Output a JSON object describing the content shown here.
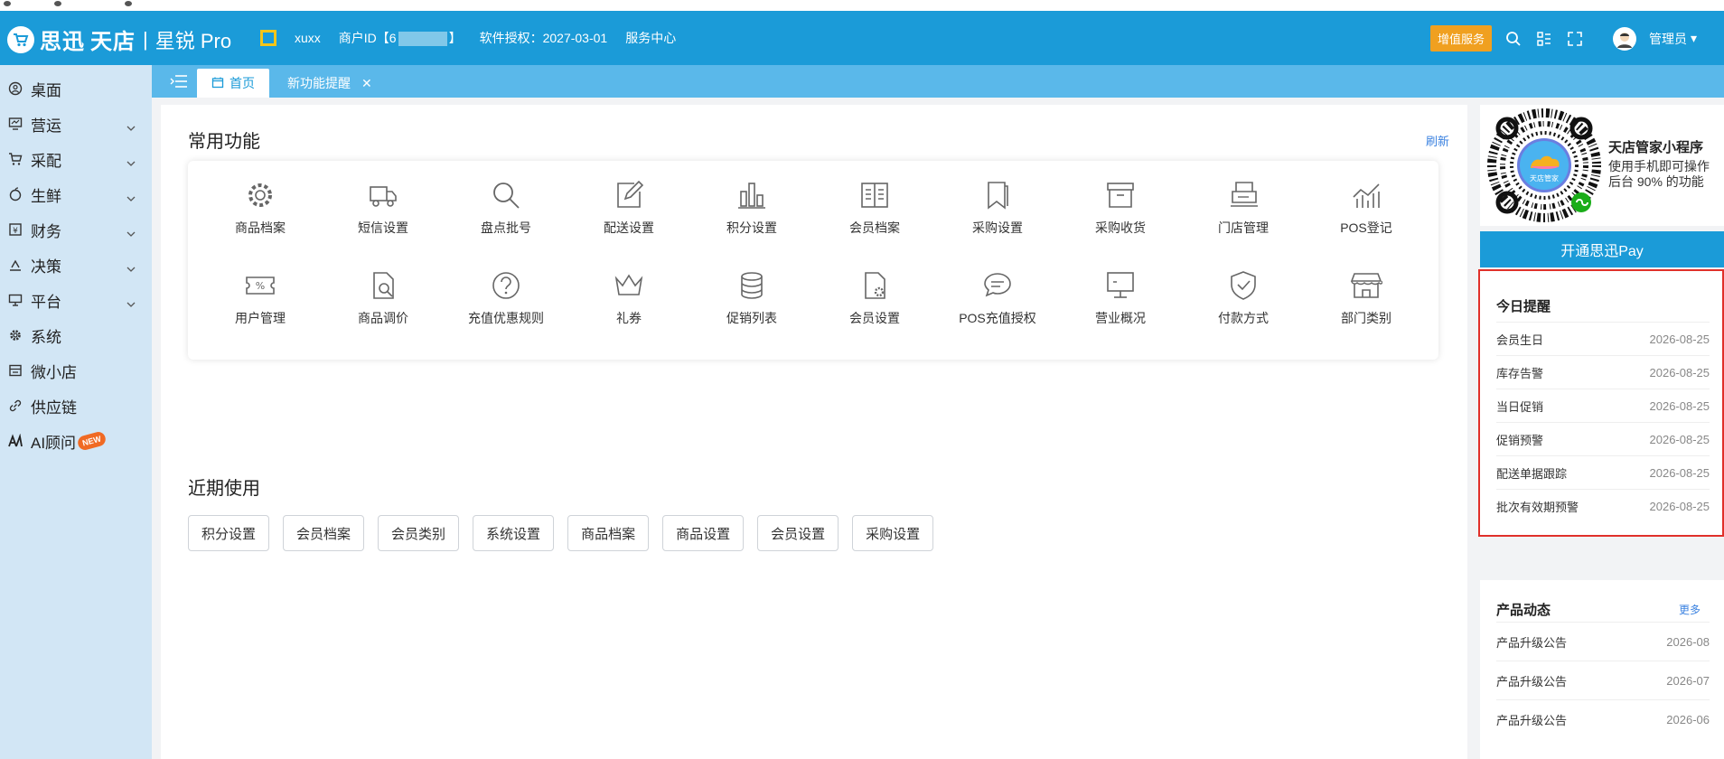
{
  "header": {
    "brand": "思迅",
    "brand2": "天店",
    "sep": "|",
    "product": "星锐 Pro",
    "username": "xuxx",
    "merchant_prefix": "商户ID【6",
    "merchant_suffix": "】",
    "license": "软件授权：2027-03-01",
    "service": "服务中心",
    "vip_label": "增值服务",
    "admin_label": "管理员"
  },
  "sidebar": {
    "items": [
      {
        "label": "桌面",
        "icon": "desktop-icon",
        "chevron": false
      },
      {
        "label": "营运",
        "icon": "operations-icon",
        "chevron": true
      },
      {
        "label": "采配",
        "icon": "cart-icon",
        "chevron": true
      },
      {
        "label": "生鲜",
        "icon": "fresh-icon",
        "chevron": true
      },
      {
        "label": "财务",
        "icon": "finance-icon",
        "chevron": true
      },
      {
        "label": "决策",
        "icon": "decision-icon",
        "chevron": true
      },
      {
        "label": "平台",
        "icon": "platform-icon",
        "chevron": true
      },
      {
        "label": "系统",
        "icon": "gear-icon",
        "chevron": false
      },
      {
        "label": "微小店",
        "icon": "shop-icon",
        "chevron": false
      },
      {
        "label": "供应链",
        "icon": "link-icon",
        "chevron": false
      },
      {
        "label": "AI顾问",
        "icon": "ai-icon",
        "chevron": false
      }
    ],
    "new_badge": "NEW"
  },
  "tabs": {
    "home": "首页",
    "notice": "新功能提醒",
    "close": "✕"
  },
  "main": {
    "common_title": "常用功能",
    "refresh": "刷新",
    "functions": [
      {
        "label": "商品档案",
        "icon": "gear-icon"
      },
      {
        "label": "短信设置",
        "icon": "truck-icon"
      },
      {
        "label": "盘点批号",
        "icon": "search-icon"
      },
      {
        "label": "配送设置",
        "icon": "edit-icon"
      },
      {
        "label": "积分设置",
        "icon": "bar-chart-icon"
      },
      {
        "label": "会员档案",
        "icon": "book-icon"
      },
      {
        "label": "采购设置",
        "icon": "bookmark-icon"
      },
      {
        "label": "采购收货",
        "icon": "archive-icon"
      },
      {
        "label": "门店管理",
        "icon": "printer-icon"
      },
      {
        "label": "POS登记",
        "icon": "trend-icon"
      },
      {
        "label": "用户管理",
        "icon": "ticket-icon"
      },
      {
        "label": "商品调价",
        "icon": "doc-search-icon"
      },
      {
        "label": "充值优惠规则",
        "icon": "question-icon"
      },
      {
        "label": "礼券",
        "icon": "crown-icon"
      },
      {
        "label": "促销列表",
        "icon": "database-icon"
      },
      {
        "label": "会员设置",
        "icon": "doc-gear-icon"
      },
      {
        "label": "POS充值授权",
        "icon": "chat-icon"
      },
      {
        "label": "营业概况",
        "icon": "monitor-icon"
      },
      {
        "label": "付款方式",
        "icon": "shield-icon"
      },
      {
        "label": "部门类别",
        "icon": "store-icon"
      }
    ],
    "recent_title": "近期使用",
    "recent": [
      "积分设置",
      "会员档案",
      "会员类别",
      "系统设置",
      "商品档案",
      "商品设置",
      "会员设置",
      "采购设置"
    ]
  },
  "right": {
    "qr_title": "天店管家小程序",
    "qr_desc": "使用手机即可操作后台 90% 的功能",
    "qr_center_label": "天店管家",
    "pay_button": "开通思迅Pay",
    "remind_title": "今日提醒",
    "reminders": [
      {
        "label": "会员生日",
        "date": "2026-08-25"
      },
      {
        "label": "库存告警",
        "date": "2026-08-25"
      },
      {
        "label": "当日促销",
        "date": "2026-08-25"
      },
      {
        "label": "促销预警",
        "date": "2026-08-25"
      },
      {
        "label": "配送单据跟踪",
        "date": "2026-08-25"
      },
      {
        "label": "批次有效期预警",
        "date": "2026-08-25"
      }
    ],
    "dynamic_title": "产品动态",
    "more": "更多",
    "dynamics": [
      {
        "label": "产品升级公告",
        "date": "2026-08"
      },
      {
        "label": "产品升级公告",
        "date": "2026-07"
      },
      {
        "label": "产品升级公告",
        "date": "2026-06"
      }
    ]
  },
  "colors": {
    "header": "#1b9bd8",
    "tabbar": "#5ab8ea",
    "sidebar": "#d2e6f5",
    "accent_orange": "#f0a020",
    "highlight_red": "#e0302a"
  }
}
